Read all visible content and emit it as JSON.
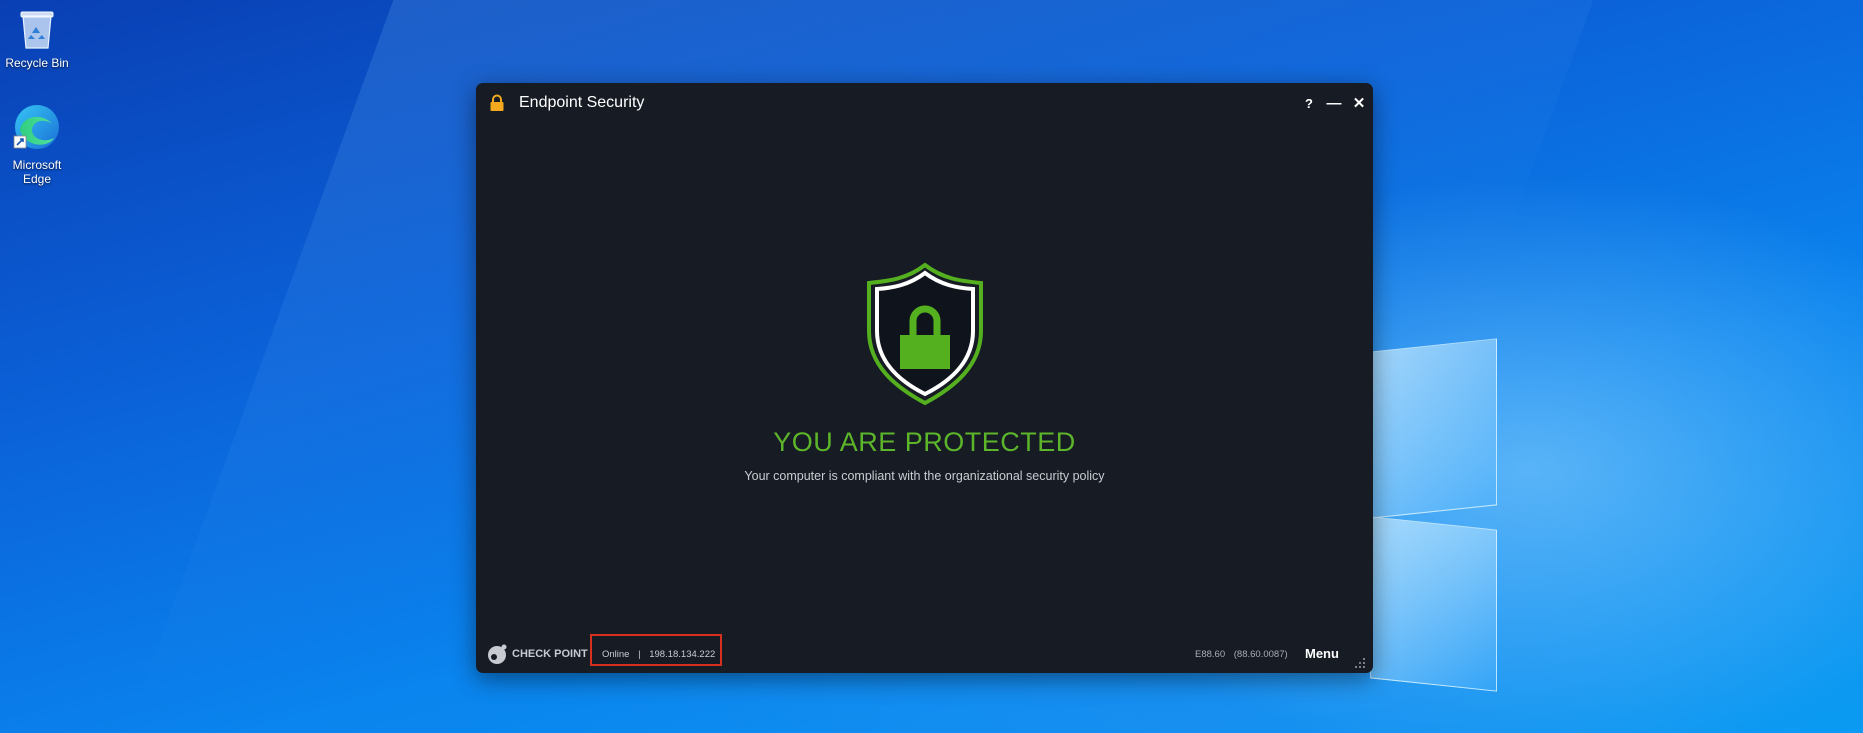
{
  "desktop": {
    "icons": [
      {
        "label": "Recycle Bin",
        "icon": "recycle-bin-icon"
      },
      {
        "label": "Microsoft Edge",
        "icon": "edge-browser-icon"
      }
    ]
  },
  "window": {
    "title": "Endpoint Security",
    "title_icon": "padlock-icon",
    "controls": {
      "help": "?",
      "minimize": "—",
      "close": "✕"
    }
  },
  "main": {
    "status_title": "YOU ARE PROTECTED",
    "status_subtitle": "Your computer is compliant with the organizational security policy",
    "status_icon": "shield-lock-icon"
  },
  "footer": {
    "brand": "CHECK POINT",
    "connection_status": "Online",
    "separator": "|",
    "ip_address": "198.18.134.222",
    "version": "E88.60",
    "build": "(88.60.0087)",
    "menu_label": "Menu"
  },
  "colors": {
    "window_bg": "#161b24",
    "accent_green": "#5db52a",
    "highlight_red": "#d6311f",
    "lock_amber": "#f3a91e"
  }
}
